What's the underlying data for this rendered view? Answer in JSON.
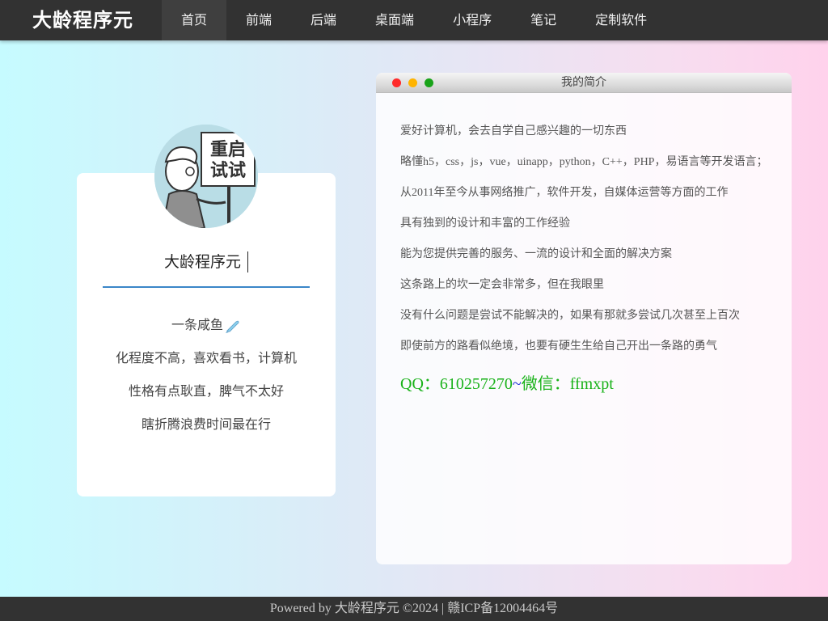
{
  "header": {
    "brand": "大龄程序元",
    "nav": [
      {
        "label": "首页",
        "active": true
      },
      {
        "label": "前端"
      },
      {
        "label": "后端"
      },
      {
        "label": "桌面端"
      },
      {
        "label": "小程序"
      },
      {
        "label": "笔记"
      },
      {
        "label": "定制软件"
      }
    ]
  },
  "profile": {
    "avatar_sign_text": [
      "重启",
      "试试"
    ],
    "name": "大龄程序元",
    "lines": [
      "一条咸鱼",
      "化程度不高，喜欢看书，计算机",
      "性格有点耿直，脾气不太好",
      "瞎折腾浪费时间最在行"
    ],
    "fish_icon": "fish-icon"
  },
  "intro_window": {
    "title": "我的简介",
    "lines": [
      "爱好计算机，会去自学自己感兴趣的一切东西",
      "略懂h5，css，js，vue，uinapp，python，C++，PHP，易语言等开发语言；",
      "从2011年至今从事网络推广，软件开发，自媒体运营等方面的工作",
      "具有独到的设计和丰富的工作经验",
      "能为您提供完善的服务、一流的设计和全面的解决方案",
      "这条路上的坎一定会非常多，但在我眼里",
      "没有什么问题是尝试不能解决的，如果有那就多尝试几次甚至上百次",
      "即使前方的路看似绝境，也要有硬生生给自己开出一条路的勇气"
    ],
    "contact": {
      "qq": "QQ：610257270",
      "separator": "~",
      "wechat": "微信：ffmxpt"
    },
    "colors": {
      "close": "#ff2a2a",
      "minimize": "#ffb400",
      "maximize": "#19a319"
    }
  },
  "footer": {
    "text": "Powered by 大龄程序元 ©2024 | 赣ICP备12004464号"
  },
  "colors": {
    "nav_bg": "#323232",
    "accent_underline": "#3a86c8",
    "contact_green": "#19b219",
    "contact_separator": "#1d2cd8"
  }
}
